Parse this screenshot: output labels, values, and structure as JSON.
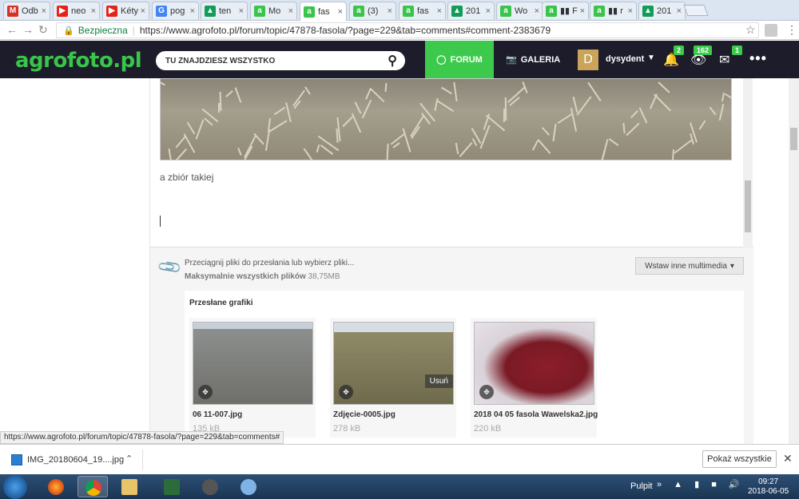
{
  "browser": {
    "tabs": [
      {
        "label": "Odb",
        "color": "#d93025",
        "glyph": "M"
      },
      {
        "label": "neo",
        "color": "#e62117",
        "glyph": "▶"
      },
      {
        "label": "Kéty",
        "color": "#e62117",
        "glyph": "▶"
      },
      {
        "label": "pog",
        "color": "#4285f4",
        "glyph": "G"
      },
      {
        "label": "ten",
        "color": "#0f9d58",
        "glyph": "▲"
      },
      {
        "label": "Mo",
        "color": "#39c44a",
        "glyph": "a"
      },
      {
        "label": "fas",
        "color": "#39c44a",
        "glyph": "a",
        "active": true
      },
      {
        "label": "(3)",
        "color": "#39c44a",
        "glyph": "a"
      },
      {
        "label": "fas",
        "color": "#39c44a",
        "glyph": "a"
      },
      {
        "label": "201",
        "color": "#0f9d58",
        "glyph": "▲"
      },
      {
        "label": "Wo",
        "color": "#39c44a",
        "glyph": "a"
      },
      {
        "label": "▮▮ F",
        "color": "#39c44a",
        "glyph": "a"
      },
      {
        "label": "▮▮ r",
        "color": "#39c44a",
        "glyph": "a"
      },
      {
        "label": "201",
        "color": "#0f9d58",
        "glyph": "▲"
      }
    ],
    "secure_label": "Bezpieczna",
    "url": "https://www.agrofoto.pl/forum/topic/47878-fasola/?page=229&tab=comments#comment-2383679"
  },
  "header": {
    "logo": "agrofoto.pl",
    "search_placeholder": "TU ZNAJDZIESZ WSZYSTKO",
    "forum_label": "FORUM",
    "galeria_label": "GALERIA",
    "avatar_letter": "D",
    "username": "dysydent",
    "notifications_count": "2",
    "views_count": "162",
    "messages_count": "1",
    "accent": "#3dca4c"
  },
  "editor": {
    "text": "a zbiór takiej"
  },
  "upload": {
    "drop_text": "Przeciągnij pliki do przesłania lub wybierz pliki...",
    "max_label": "Maksymalnie wszystkich plików",
    "max_value": "38,75MB",
    "insert_label": "Wstaw inne multimedia",
    "uploaded_title": "Przesłane grafiki",
    "files": [
      {
        "name": "06 11-007.jpg",
        "size": "135 kB"
      },
      {
        "name": "Zdjęcie-0005.jpg",
        "size": "278 kB",
        "delete_label": "Usuń"
      },
      {
        "name": "2018 04 05 fasola Wawelska2.jpg",
        "size": "220 kB"
      }
    ]
  },
  "status_url": "https://www.agrofoto.pl/forum/topic/47878-fasola/?page=229&tab=comments#",
  "download": {
    "file": "IMG_20180604_19....jpg",
    "show_all": "Pokaż wszystkie"
  },
  "taskbar": {
    "pulpit": "Pulpit",
    "time": "09:27",
    "date": "2018-06-05"
  }
}
